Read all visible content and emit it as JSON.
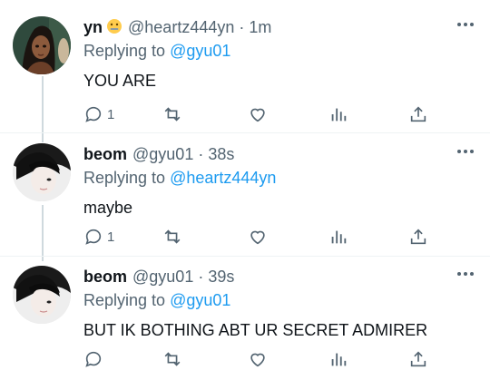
{
  "colors": {
    "text": "#0f1419",
    "secondary": "#536471",
    "link": "#1d9bf0",
    "line": "#cfd9de"
  },
  "tweets": [
    {
      "name": "yn",
      "emoji": "zipper-mouth-face-emoji",
      "handle": "@heartz444yn",
      "separator": "·",
      "time": "1m",
      "replying_prefix": "Replying to ",
      "replying_to": "@gyu01",
      "text": "YOU ARE",
      "reply_count": "1",
      "retweet_count": "",
      "like_count": "",
      "views_count": ""
    },
    {
      "name": "beom",
      "handle": "@gyu01",
      "separator": "·",
      "time": "38s",
      "replying_prefix": "Replying to ",
      "replying_to": "@heartz444yn",
      "text": "maybe",
      "reply_count": "1",
      "retweet_count": "",
      "like_count": "",
      "views_count": ""
    },
    {
      "name": "beom",
      "handle": "@gyu01",
      "separator": "·",
      "time": "39s",
      "replying_prefix": "Replying to ",
      "replying_to": "@gyu01",
      "text": "BUT IK BOTHING ABT UR SECRET ADMIRER",
      "reply_count": "",
      "retweet_count": "",
      "like_count": "",
      "views_count": ""
    }
  ],
  "icons": [
    "reply-icon",
    "retweet-icon",
    "like-icon",
    "views-icon",
    "share-icon",
    "more-icon"
  ]
}
